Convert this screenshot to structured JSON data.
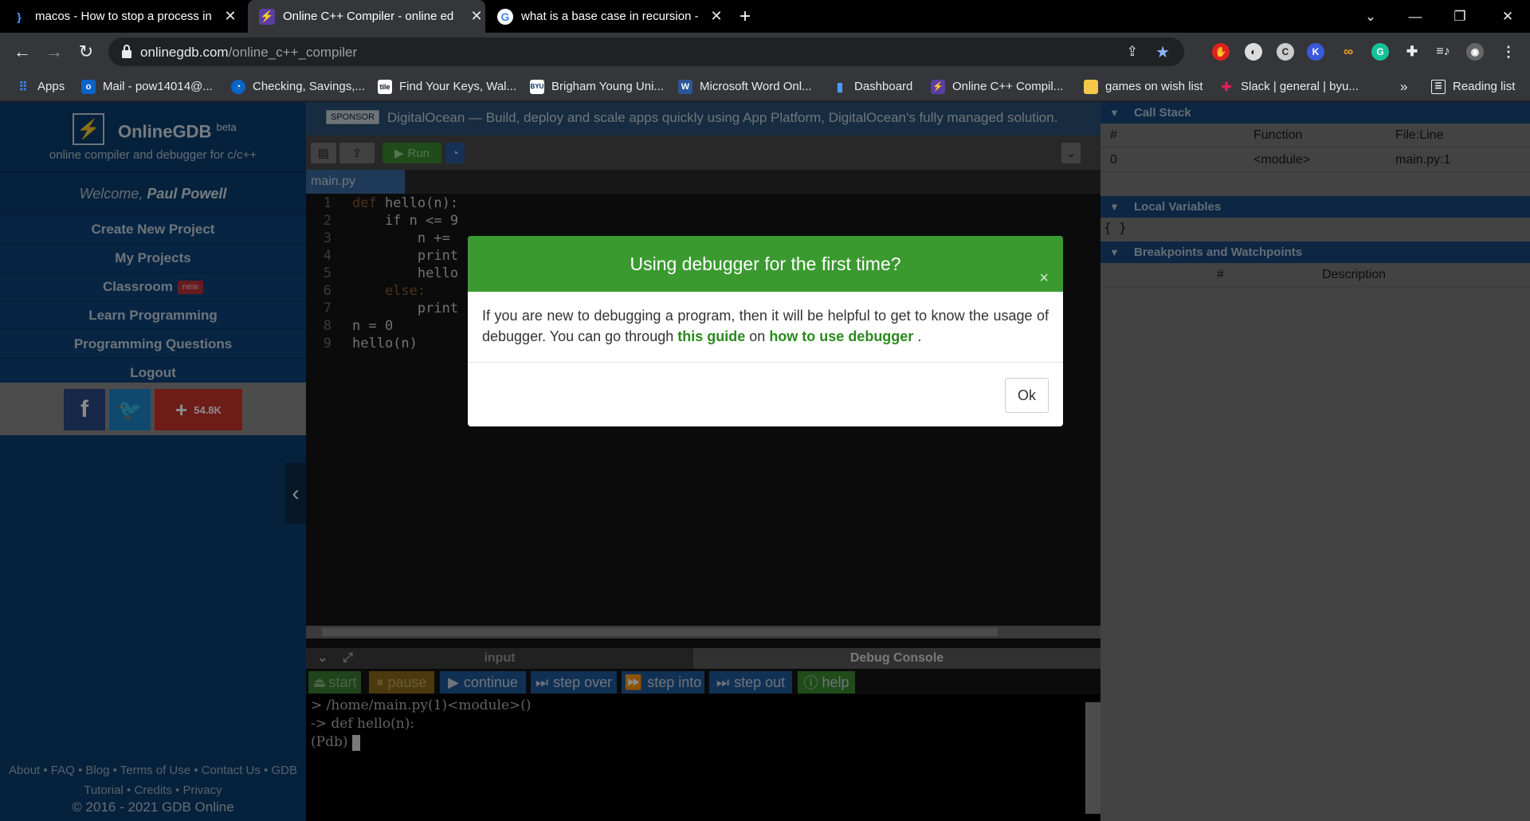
{
  "browser": {
    "tabs": [
      {
        "title": "macos - How to stop a process in",
        "icon": "brackets-icon"
      },
      {
        "title": "Online C++ Compiler - online ed",
        "icon": "bolt-icon"
      },
      {
        "title": "what is a base case in recursion -",
        "icon": "google-icon"
      }
    ],
    "new_tab": "+",
    "url_domain": "onlinegdb.com",
    "url_path": "/online_c++_compiler",
    "bookmarks": [
      {
        "label": "Apps",
        "icon": "apps-grid-icon"
      },
      {
        "label": "Mail - pow14014@...",
        "icon": "outlook-icon"
      },
      {
        "label": "Checking, Savings,...",
        "icon": "bank-icon"
      },
      {
        "label": "Find Your Keys, Wal...",
        "icon": "tile-icon"
      },
      {
        "label": "Brigham Young Uni...",
        "icon": "byu-icon"
      },
      {
        "label": "Microsoft Word Onl...",
        "icon": "word-icon"
      },
      {
        "label": "Dashboard",
        "icon": "chart-icon"
      },
      {
        "label": "Online C++ Compil...",
        "icon": "bolt-icon"
      },
      {
        "label": "games on wish list",
        "icon": "folder-icon"
      },
      {
        "label": "Slack | general | byu...",
        "icon": "slack-icon"
      }
    ],
    "bookmarks_more": "»",
    "reading_list": "Reading list"
  },
  "sidebar": {
    "brand": "OnlineGDB",
    "brand_beta": "beta",
    "tagline": "online compiler and debugger for c/c++",
    "welcome_prefix": "Welcome,",
    "user_name": "Paul Powell",
    "menu": [
      {
        "label": "Create New Project"
      },
      {
        "label": "My Projects"
      },
      {
        "label": "Classroom",
        "badge": "new"
      },
      {
        "label": "Learn Programming"
      },
      {
        "label": "Programming Questions"
      },
      {
        "label": "Logout"
      }
    ],
    "share_count": "54.8K",
    "footer_links_line1": "About • FAQ • Blog • Terms of Use • Contact Us • GDB",
    "footer_links_line2": "Tutorial • Credits • Privacy",
    "copyright": "© 2016 - 2021 GDB Online"
  },
  "sponsor": {
    "tag": "SPONSOR",
    "text": "DigitalOcean — Build, deploy and scale apps quickly using App Platform, DigitalOcean's fully managed solution."
  },
  "editor": {
    "run_label": "Run",
    "file_name": "main.py",
    "lines": [
      {
        "num": "1",
        "code": "def hello(n):"
      },
      {
        "num": "2",
        "code": "    if n <= 9"
      },
      {
        "num": "3",
        "code": "        n +="
      },
      {
        "num": "4",
        "code": "        print"
      },
      {
        "num": "5",
        "code": "        hello"
      },
      {
        "num": "6",
        "code": "    else:"
      },
      {
        "num": "7",
        "code": "        print"
      },
      {
        "num": "8",
        "code": "n = 0"
      },
      {
        "num": "9",
        "code": "hello(n)"
      }
    ]
  },
  "panel": {
    "tab_input": "input",
    "tab_debug": "Debug Console",
    "buttons": {
      "start": "start",
      "pause": "pause",
      "continue": "continue",
      "step_over": "step over",
      "step_into": "step into",
      "step_out": "step out",
      "help": "help"
    },
    "console_lines": [
      "> /home/main.py(1)<module>()",
      "-> def hello(n):",
      "(Pdb)"
    ]
  },
  "debug_panel": {
    "call_stack_title": "Call Stack",
    "call_stack_headers": [
      "#",
      "Function",
      "File:Line"
    ],
    "call_stack_rows": [
      [
        "0",
        "<module>",
        "main.py:1"
      ]
    ],
    "locals_title": "Local Variables",
    "locals_value": "{ }",
    "breakpoints_title": "Breakpoints and Watchpoints",
    "breakpoints_headers": [
      "#",
      "Description"
    ]
  },
  "modal": {
    "title": "Using debugger for the first time?",
    "close": "×",
    "body_text": "If you are new to debugging a program, then it will be helpful to get to know the usage of debugger. You can go through",
    "link1": "this guide",
    "mid_text": "on",
    "link2": "how to use debugger",
    "end_text": ".",
    "ok_label": "Ok"
  },
  "colors": {
    "modal_header": "#3a9a2f",
    "sidebar_bg": "#0b3d6e",
    "link_green": "#2a8a1f"
  }
}
